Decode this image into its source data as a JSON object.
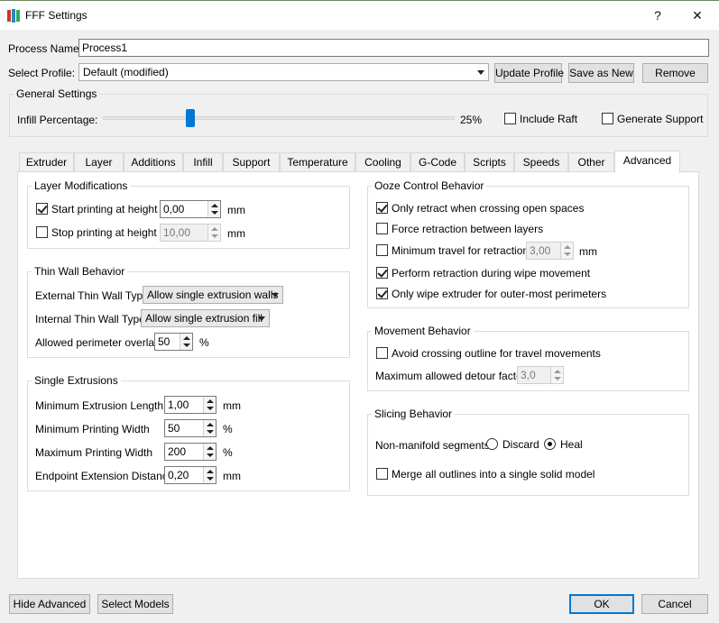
{
  "window": {
    "title": "FFF Settings",
    "help_glyph": "?",
    "close_glyph": "✕"
  },
  "process": {
    "label": "Process Name:",
    "value": "Process1"
  },
  "profile": {
    "label": "Select Profile:",
    "value": "Default (modified)",
    "update_label": "Update Profile",
    "save_as_new_label": "Save as New",
    "remove_label": "Remove"
  },
  "general": {
    "title": "General Settings",
    "infill_label": "Infill Percentage:",
    "infill_value_text": "25%",
    "infill_fraction": 0.25,
    "include_raft_label": "Include Raft",
    "include_raft_checked": false,
    "generate_support_label": "Generate Support",
    "generate_support_checked": false
  },
  "tabs": [
    "Extruder",
    "Layer",
    "Additions",
    "Infill",
    "Support",
    "Temperature",
    "Cooling",
    "G-Code",
    "Scripts",
    "Speeds",
    "Other",
    "Advanced"
  ],
  "active_tab": "Advanced",
  "layer_mod": {
    "title": "Layer Modifications",
    "start_label": "Start printing at height",
    "start_checked": true,
    "start_value": "0,00",
    "start_unit": "mm",
    "stop_label": "Stop printing at height",
    "stop_checked": false,
    "stop_value": "10,00",
    "stop_unit": "mm"
  },
  "thin_wall": {
    "title": "Thin Wall Behavior",
    "external_label": "External Thin Wall Type",
    "external_value": "Allow single extrusion walls",
    "internal_label": "Internal Thin Wall Type",
    "internal_value": "Allow single extrusion fill",
    "overlap_label": "Allowed perimeter overlap",
    "overlap_value": "50",
    "overlap_unit": "%"
  },
  "single_ext": {
    "title": "Single Extrusions",
    "rows": [
      {
        "label": "Minimum Extrusion Length",
        "value": "1,00",
        "unit": "mm"
      },
      {
        "label": "Minimum Printing Width",
        "value": "50",
        "unit": "%"
      },
      {
        "label": "Maximum Printing Width",
        "value": "200",
        "unit": "%"
      },
      {
        "label": "Endpoint Extension Distance",
        "value": "0,20",
        "unit": "mm"
      }
    ]
  },
  "ooze": {
    "title": "Ooze Control Behavior",
    "only_retract_label": "Only retract when crossing open spaces",
    "only_retract_checked": true,
    "force_retract_label": "Force retraction between layers",
    "force_retract_checked": false,
    "min_travel_label": "Minimum travel for retraction",
    "min_travel_checked": false,
    "min_travel_value": "3,00",
    "min_travel_unit": "mm",
    "perform_retract_label": "Perform retraction during wipe movement",
    "perform_retract_checked": true,
    "only_wipe_label": "Only wipe extruder for outer-most perimeters",
    "only_wipe_checked": true
  },
  "movement": {
    "title": "Movement Behavior",
    "avoid_label": "Avoid crossing outline for travel movements",
    "avoid_checked": false,
    "detour_label": "Maximum allowed detour factor",
    "detour_value": "3,0"
  },
  "slicing": {
    "title": "Slicing Behavior",
    "nonmanifold_label": "Non-manifold segments:",
    "discard_label": "Discard",
    "heal_label": "Heal",
    "selected": "Heal",
    "merge_label": "Merge all outlines into a single solid model",
    "merge_checked": false
  },
  "footer": {
    "hide_advanced_label": "Hide Advanced",
    "select_models_label": "Select Models",
    "ok_label": "OK",
    "cancel_label": "Cancel"
  },
  "colors": {
    "accent": "#0078d7",
    "slider_thumb": "#0078d7"
  }
}
